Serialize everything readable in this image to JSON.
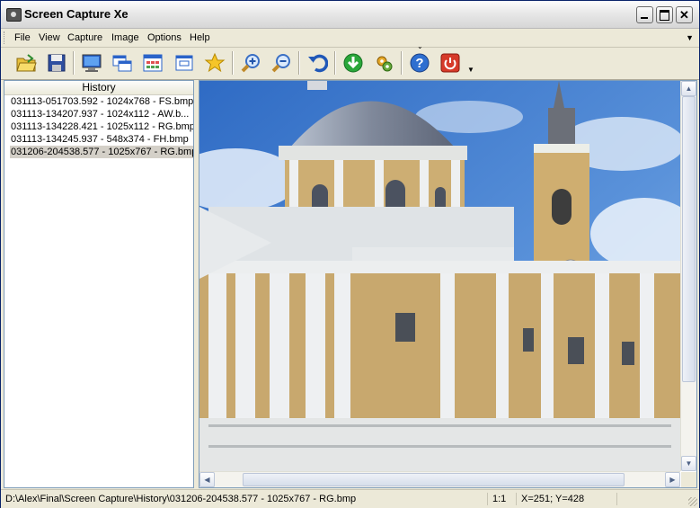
{
  "window": {
    "title": "Screen Capture Xe"
  },
  "menu": {
    "items": [
      "File",
      "View",
      "Capture",
      "Image",
      "Options",
      "Help"
    ]
  },
  "toolbar": {
    "buttons": [
      "open-folder-icon",
      "save-disk-icon",
      "capture-desktop-icon",
      "capture-window-icon",
      "capture-region-icon",
      "capture-control-icon",
      "favorite-star-icon",
      "zoom-in-icon",
      "zoom-out-icon",
      "undo-icon",
      "download-icon",
      "settings-gear-icon",
      "help-icon",
      "power-icon"
    ]
  },
  "history": {
    "header": "History",
    "items": [
      "031113-051703.592 - 1024x768 - FS.bmp",
      "031113-134207.937 - 1024x112 - AW.b...",
      "031113-134228.421 - 1025x112 - RG.bmp",
      "031113-134245.937 - 548x374 - FH.bmp",
      "031206-204538.577 - 1025x767 - RG.bmp"
    ],
    "selected_index": 4
  },
  "status": {
    "path": "D:\\Alex\\Final\\Screen Capture\\History\\031206-204538.577 - 1025x767 - RG.bmp",
    "zoom": "1:1",
    "coords": "X=251; Y=428"
  },
  "colors": {
    "sky": "#3a76c9",
    "dome": "#8f97a8",
    "facade": "#c9ac74",
    "columns": "#e9ecef"
  }
}
